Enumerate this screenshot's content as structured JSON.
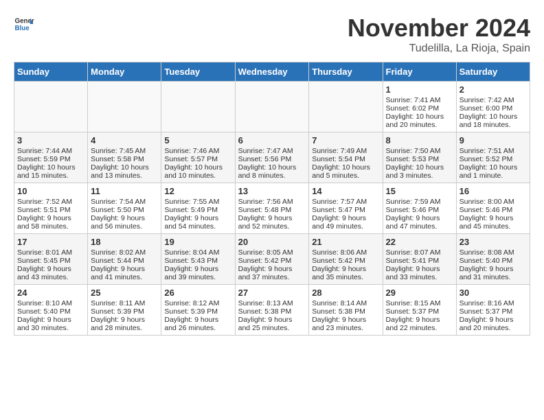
{
  "header": {
    "logo_general": "General",
    "logo_blue": "Blue",
    "month": "November 2024",
    "location": "Tudelilla, La Rioja, Spain"
  },
  "days_of_week": [
    "Sunday",
    "Monday",
    "Tuesday",
    "Wednesday",
    "Thursday",
    "Friday",
    "Saturday"
  ],
  "weeks": [
    [
      {
        "day": "",
        "content": ""
      },
      {
        "day": "",
        "content": ""
      },
      {
        "day": "",
        "content": ""
      },
      {
        "day": "",
        "content": ""
      },
      {
        "day": "",
        "content": ""
      },
      {
        "day": "1",
        "content": "Sunrise: 7:41 AM\nSunset: 6:02 PM\nDaylight: 10 hours and 20 minutes."
      },
      {
        "day": "2",
        "content": "Sunrise: 7:42 AM\nSunset: 6:00 PM\nDaylight: 10 hours and 18 minutes."
      }
    ],
    [
      {
        "day": "3",
        "content": "Sunrise: 7:44 AM\nSunset: 5:59 PM\nDaylight: 10 hours and 15 minutes."
      },
      {
        "day": "4",
        "content": "Sunrise: 7:45 AM\nSunset: 5:58 PM\nDaylight: 10 hours and 13 minutes."
      },
      {
        "day": "5",
        "content": "Sunrise: 7:46 AM\nSunset: 5:57 PM\nDaylight: 10 hours and 10 minutes."
      },
      {
        "day": "6",
        "content": "Sunrise: 7:47 AM\nSunset: 5:56 PM\nDaylight: 10 hours and 8 minutes."
      },
      {
        "day": "7",
        "content": "Sunrise: 7:49 AM\nSunset: 5:54 PM\nDaylight: 10 hours and 5 minutes."
      },
      {
        "day": "8",
        "content": "Sunrise: 7:50 AM\nSunset: 5:53 PM\nDaylight: 10 hours and 3 minutes."
      },
      {
        "day": "9",
        "content": "Sunrise: 7:51 AM\nSunset: 5:52 PM\nDaylight: 10 hours and 1 minute."
      }
    ],
    [
      {
        "day": "10",
        "content": "Sunrise: 7:52 AM\nSunset: 5:51 PM\nDaylight: 9 hours and 58 minutes."
      },
      {
        "day": "11",
        "content": "Sunrise: 7:54 AM\nSunset: 5:50 PM\nDaylight: 9 hours and 56 minutes."
      },
      {
        "day": "12",
        "content": "Sunrise: 7:55 AM\nSunset: 5:49 PM\nDaylight: 9 hours and 54 minutes."
      },
      {
        "day": "13",
        "content": "Sunrise: 7:56 AM\nSunset: 5:48 PM\nDaylight: 9 hours and 52 minutes."
      },
      {
        "day": "14",
        "content": "Sunrise: 7:57 AM\nSunset: 5:47 PM\nDaylight: 9 hours and 49 minutes."
      },
      {
        "day": "15",
        "content": "Sunrise: 7:59 AM\nSunset: 5:46 PM\nDaylight: 9 hours and 47 minutes."
      },
      {
        "day": "16",
        "content": "Sunrise: 8:00 AM\nSunset: 5:46 PM\nDaylight: 9 hours and 45 minutes."
      }
    ],
    [
      {
        "day": "17",
        "content": "Sunrise: 8:01 AM\nSunset: 5:45 PM\nDaylight: 9 hours and 43 minutes."
      },
      {
        "day": "18",
        "content": "Sunrise: 8:02 AM\nSunset: 5:44 PM\nDaylight: 9 hours and 41 minutes."
      },
      {
        "day": "19",
        "content": "Sunrise: 8:04 AM\nSunset: 5:43 PM\nDaylight: 9 hours and 39 minutes."
      },
      {
        "day": "20",
        "content": "Sunrise: 8:05 AM\nSunset: 5:42 PM\nDaylight: 9 hours and 37 minutes."
      },
      {
        "day": "21",
        "content": "Sunrise: 8:06 AM\nSunset: 5:42 PM\nDaylight: 9 hours and 35 minutes."
      },
      {
        "day": "22",
        "content": "Sunrise: 8:07 AM\nSunset: 5:41 PM\nDaylight: 9 hours and 33 minutes."
      },
      {
        "day": "23",
        "content": "Sunrise: 8:08 AM\nSunset: 5:40 PM\nDaylight: 9 hours and 31 minutes."
      }
    ],
    [
      {
        "day": "24",
        "content": "Sunrise: 8:10 AM\nSunset: 5:40 PM\nDaylight: 9 hours and 30 minutes."
      },
      {
        "day": "25",
        "content": "Sunrise: 8:11 AM\nSunset: 5:39 PM\nDaylight: 9 hours and 28 minutes."
      },
      {
        "day": "26",
        "content": "Sunrise: 8:12 AM\nSunset: 5:39 PM\nDaylight: 9 hours and 26 minutes."
      },
      {
        "day": "27",
        "content": "Sunrise: 8:13 AM\nSunset: 5:38 PM\nDaylight: 9 hours and 25 minutes."
      },
      {
        "day": "28",
        "content": "Sunrise: 8:14 AM\nSunset: 5:38 PM\nDaylight: 9 hours and 23 minutes."
      },
      {
        "day": "29",
        "content": "Sunrise: 8:15 AM\nSunset: 5:37 PM\nDaylight: 9 hours and 22 minutes."
      },
      {
        "day": "30",
        "content": "Sunrise: 8:16 AM\nSunset: 5:37 PM\nDaylight: 9 hours and 20 minutes."
      }
    ]
  ]
}
